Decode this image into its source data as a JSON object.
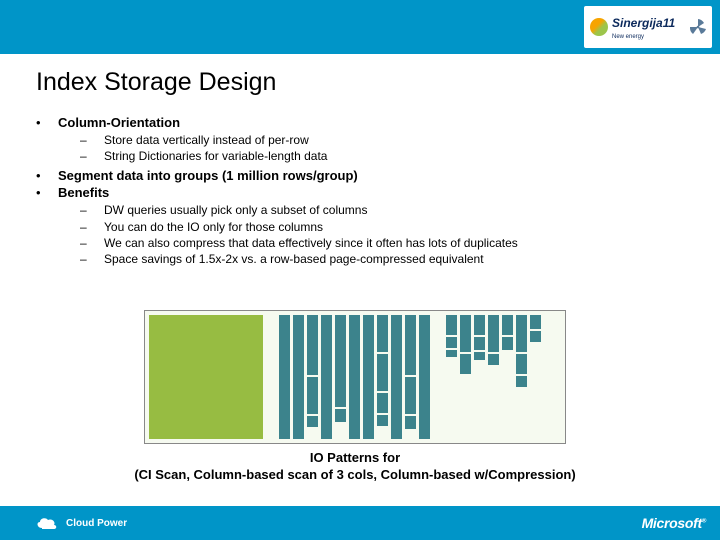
{
  "header": {
    "logo_brand": "Sinergija",
    "logo_num": "11",
    "logo_tag": "New energy"
  },
  "title": "Index Storage Design",
  "bullets": {
    "b1": "Column-Orientation",
    "b1_subs": [
      "Store data vertically instead of per-row",
      "String Dictionaries for variable-length data"
    ],
    "b2": "Segment data into groups (1 million rows/group)",
    "b3": "Benefits",
    "b3_subs": [
      "DW queries usually pick only a subset of columns",
      "You can do the IO only for those columns",
      "We can also compress that data effectively since it often has lots of duplicates",
      "Space savings of 1.5x-2x vs. a row-based page-compressed equivalent"
    ]
  },
  "caption_l1": "IO Patterns for",
  "caption_l2": "(CI Scan, Column-based scan of 3 cols, Column-based w/Compression)",
  "footer": {
    "cloud": "Cloud Power",
    "vendor": "Microsoft"
  }
}
